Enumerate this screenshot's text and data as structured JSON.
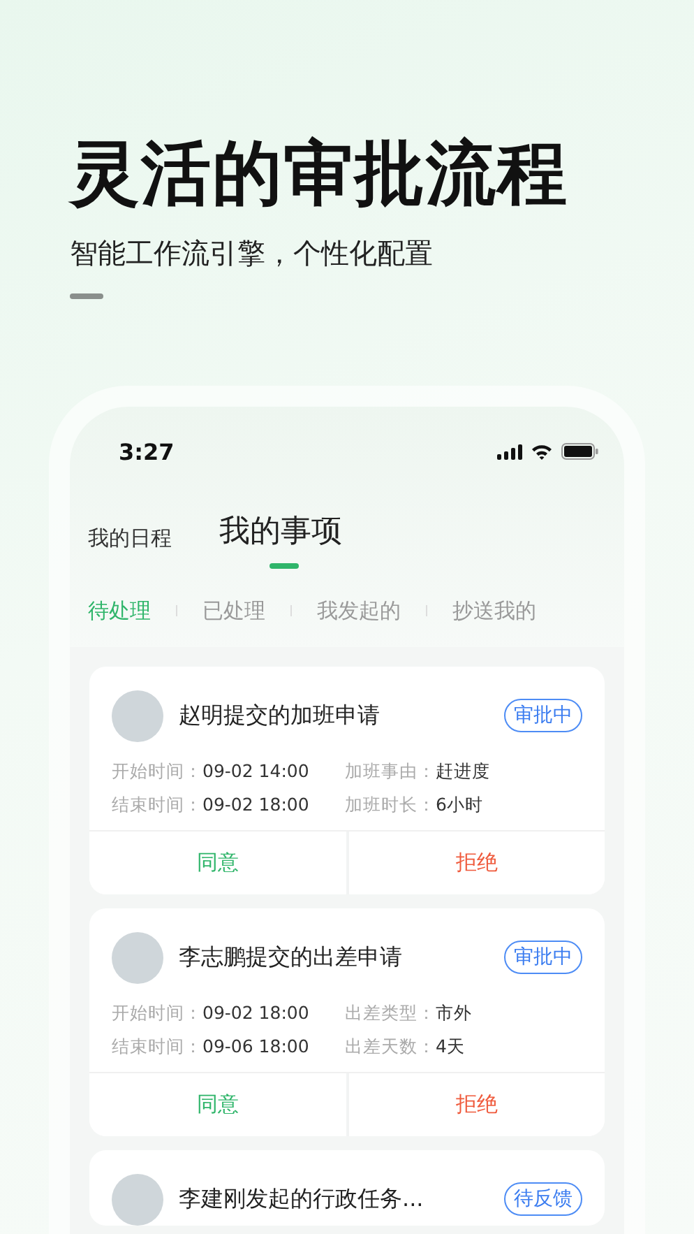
{
  "headline": "灵活的审批流程",
  "subtitle": "智能工作流引擎，个性化配置",
  "status_bar": {
    "time": "3:27"
  },
  "main_tabs": [
    {
      "label": "我的日程",
      "selected": false
    },
    {
      "label": "我的事项",
      "selected": true
    }
  ],
  "sub_tabs": [
    {
      "label": "待处理",
      "selected": true
    },
    {
      "label": "已处理",
      "selected": false
    },
    {
      "label": "我发起的",
      "selected": false
    },
    {
      "label": "抄送我的",
      "selected": false
    }
  ],
  "cards": [
    {
      "title": "赵明提交的加班申请",
      "status": "审批中",
      "fields": [
        {
          "label": "开始时间：",
          "value": "09-02 14:00"
        },
        {
          "label": "加班事由：",
          "value": "赶进度"
        },
        {
          "label": "结束时间：",
          "value": "09-02 18:00"
        },
        {
          "label": "加班时长：",
          "value": "6小时"
        }
      ],
      "actions": [
        {
          "label": "同意",
          "kind": "approve"
        },
        {
          "label": "拒绝",
          "kind": "reject"
        }
      ]
    },
    {
      "title": "李志鹏提交的出差申请",
      "status": "审批中",
      "fields": [
        {
          "label": "开始时间：",
          "value": "09-02 18:00"
        },
        {
          "label": "出差类型：",
          "value": "市外"
        },
        {
          "label": "结束时间：",
          "value": "09-06 18:00"
        },
        {
          "label": "出差天数：",
          "value": "4天"
        }
      ],
      "actions": [
        {
          "label": "同意",
          "kind": "approve"
        },
        {
          "label": "拒绝",
          "kind": "reject"
        }
      ]
    },
    {
      "title": "李建刚发起的行政任务...",
      "status": "待反馈"
    }
  ]
}
